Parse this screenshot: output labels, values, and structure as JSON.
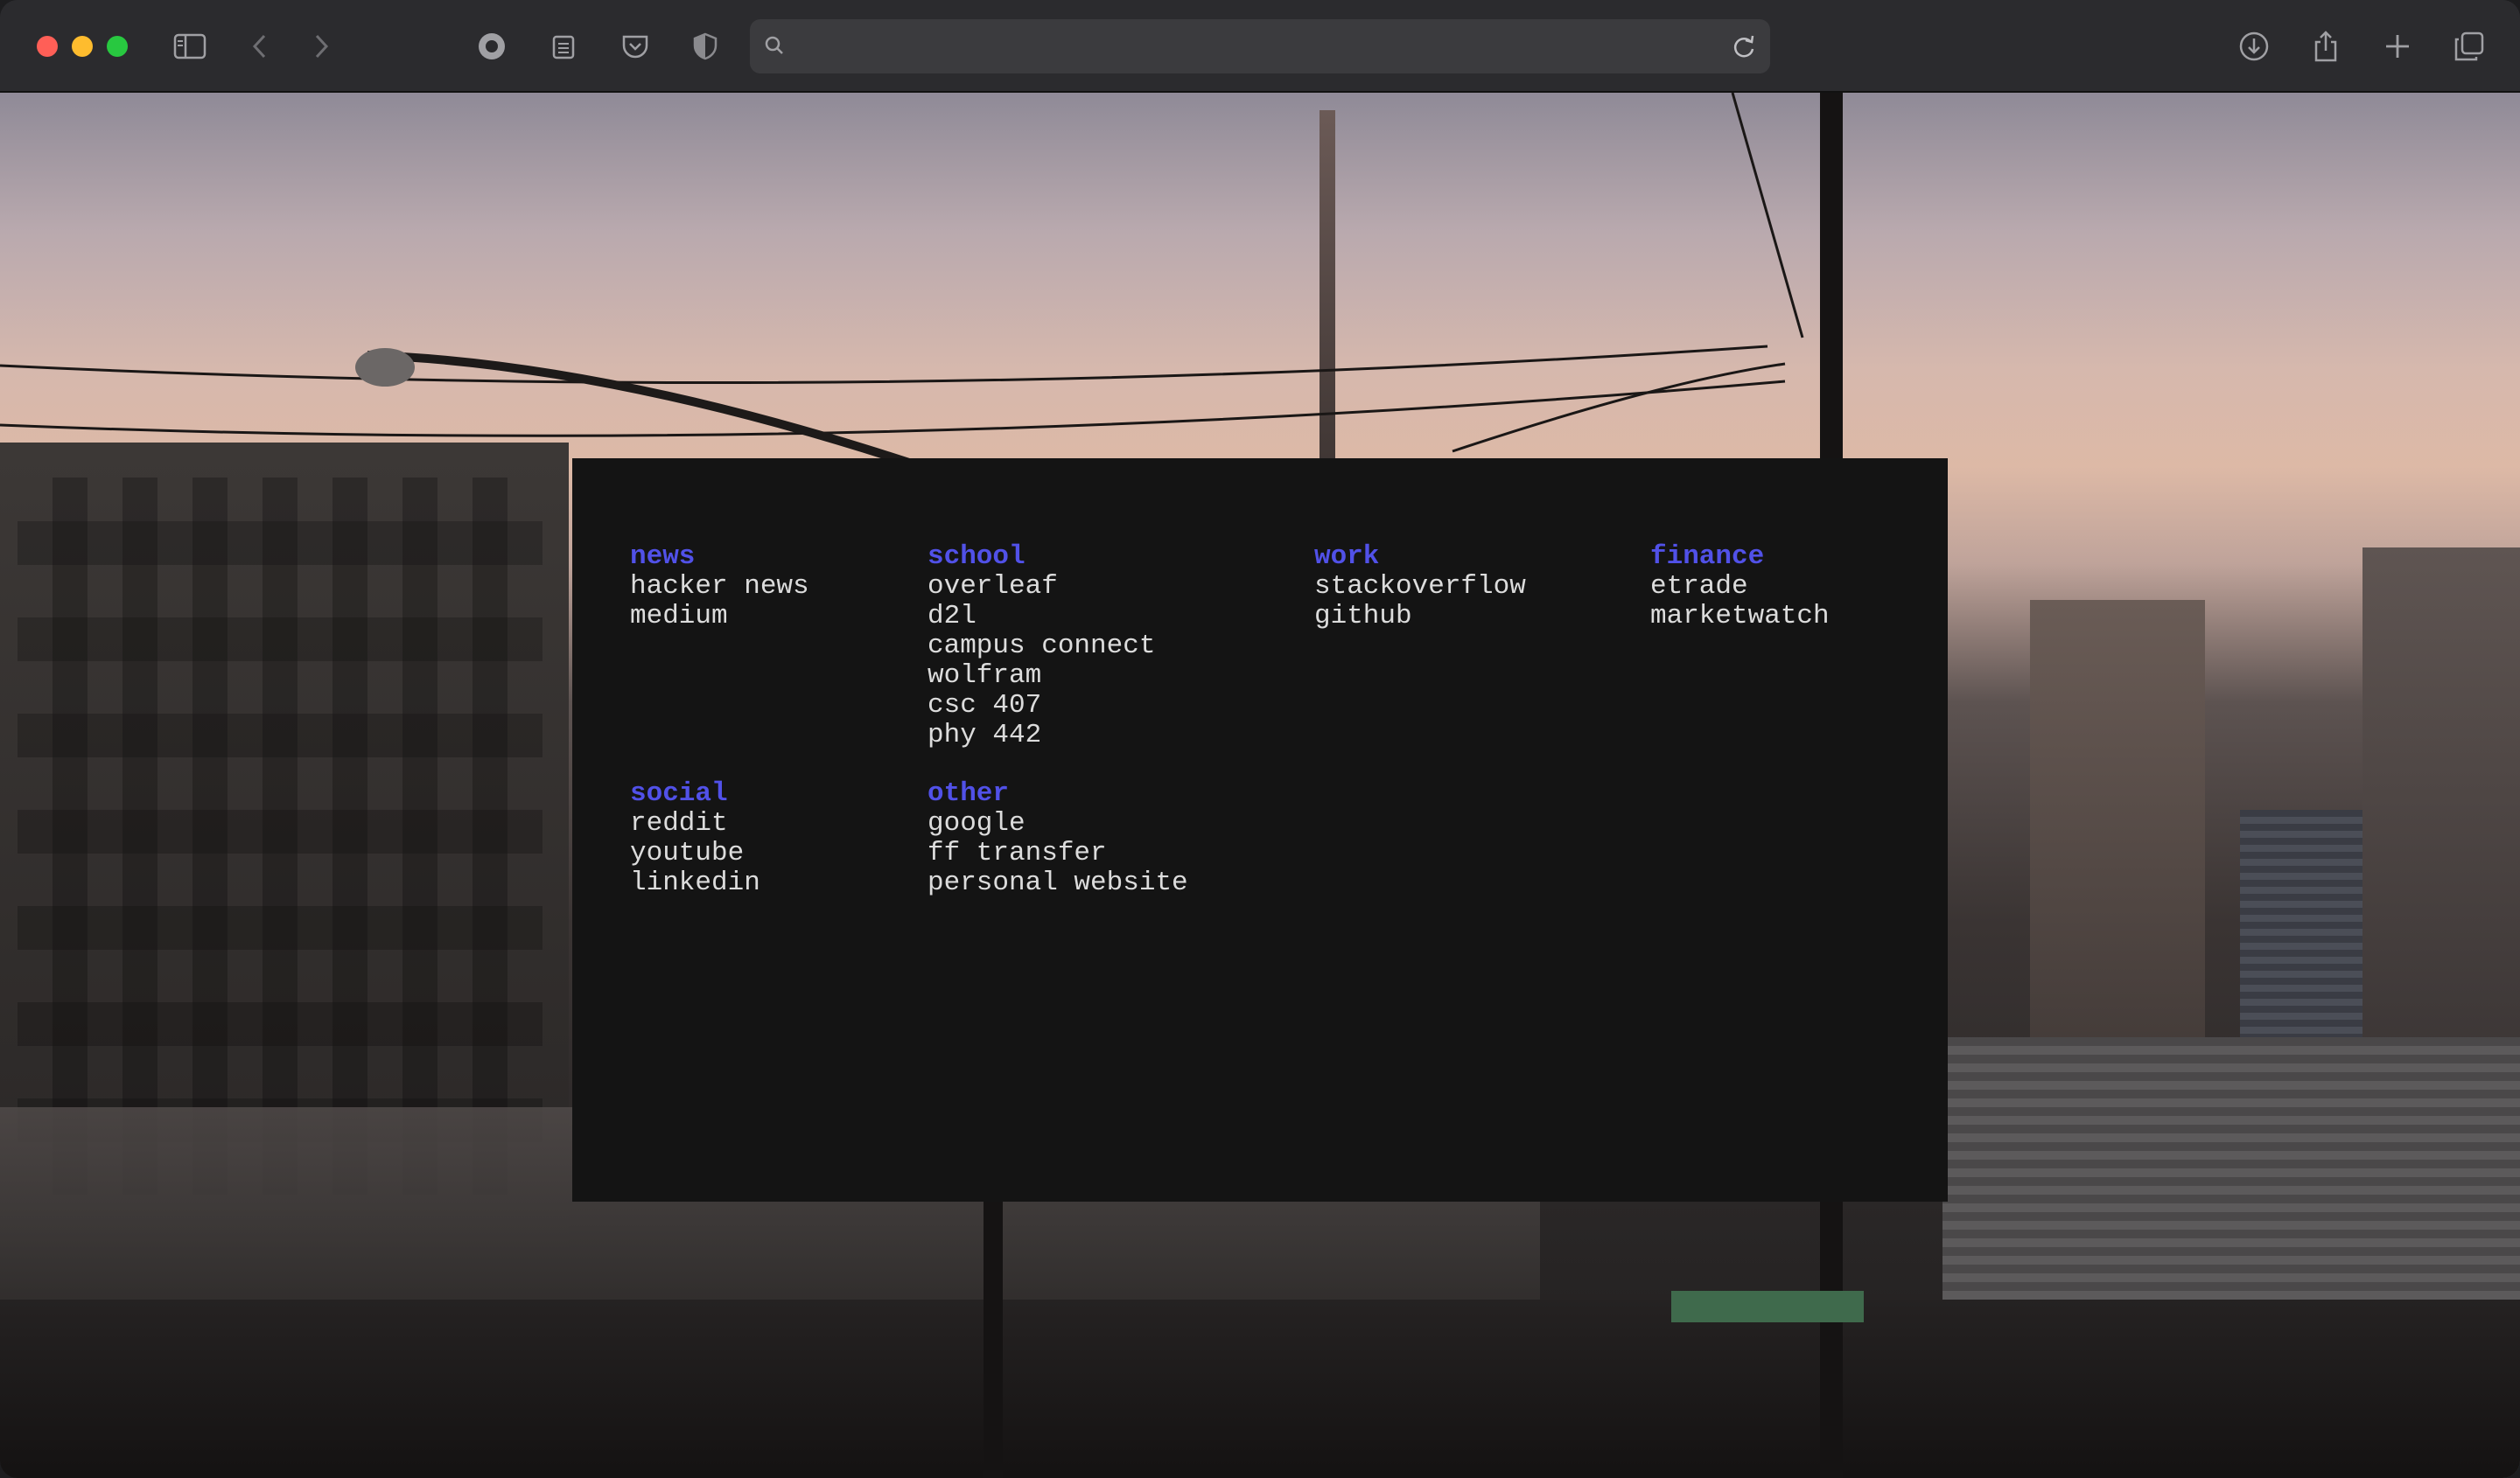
{
  "browser": {
    "url_placeholder": "",
    "icons": {
      "sidebar": "sidebar-icon",
      "back": "chevron-left-icon",
      "forward": "chevron-right-icon",
      "ext1": "privacy-extension-icon",
      "ext2": "clipboard-extension-icon",
      "ext3": "pocket-icon",
      "ext4": "shield-icon",
      "search": "search-icon",
      "reload": "reload-icon",
      "download": "download-icon",
      "share": "share-icon",
      "new_tab": "plus-icon",
      "tabs": "tab-overview-icon"
    }
  },
  "startpage": {
    "colors": {
      "heading": "#5151e8",
      "link": "#dcdcdc",
      "panel": "#141414"
    },
    "groups": [
      {
        "key": "news",
        "title": "news",
        "links": [
          "hacker news",
          "medium"
        ]
      },
      {
        "key": "school",
        "title": "school",
        "links": [
          "overleaf",
          "d2l",
          "campus connect",
          "wolfram",
          "csc 407",
          "phy 442"
        ]
      },
      {
        "key": "work",
        "title": "work",
        "links": [
          "stackoverflow",
          "github"
        ]
      },
      {
        "key": "finance",
        "title": "finance",
        "links": [
          "etrade",
          "marketwatch"
        ]
      },
      {
        "key": "social",
        "title": "social",
        "links": [
          "reddit",
          "youtube",
          "linkedin"
        ]
      },
      {
        "key": "other",
        "title": "other",
        "links": [
          "google",
          "ff transfer",
          "personal website"
        ]
      }
    ]
  }
}
